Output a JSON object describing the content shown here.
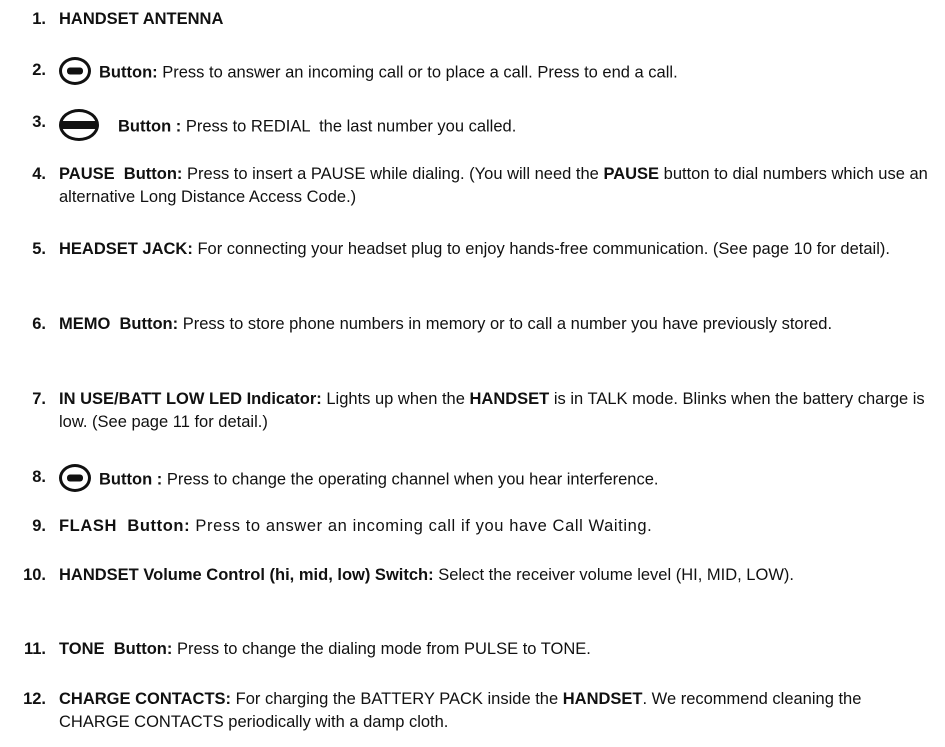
{
  "items": [
    {
      "number": "1.",
      "title": "HANDSET ANTENNA"
    },
    {
      "number": "2.",
      "icon": "talk-button-icon",
      "title": "Button:",
      "desc": "Press to answer an incoming call or to place a call. Press to end a call."
    },
    {
      "number": "3.",
      "icon": "redial-button-icon",
      "title": "Button :",
      "desc": "Press to REDIAL  the last number you called."
    },
    {
      "number": "4.",
      "title": "PAUSE  Button:",
      "desc_a": "Press to insert a PAUSE while dialing. (You will need the",
      "emph": "PAUSE",
      "desc_b": "button to dial numbers which use an alternative Long Distance Access Code.)"
    },
    {
      "number": "5.",
      "title": "HEADSET JACK:",
      "desc": "For connecting your headset plug to enjoy hands-free communication. (See page 10 for detail)."
    },
    {
      "number": "6.",
      "title": "MEMO  Button:",
      "desc": "Press to store phone numbers in memory or to call a number you have previously stored."
    },
    {
      "number": "7.",
      "title": "IN USE/BATT LOW LED Indicator:",
      "desc_a": "Lights up when the",
      "emph": "HANDSET",
      "desc_b": "is in TALK mode. Blinks when the battery charge is low. (See page 11 for detail.)"
    },
    {
      "number": "8.",
      "icon": "channel-button-icon",
      "title": "Button :",
      "desc": "Press to change the operating channel when you hear interference."
    },
    {
      "number": "9.",
      "title": "FLASH  Button:",
      "desc": "Press to answer an incoming call if you have Call Waiting."
    },
    {
      "number": "10.",
      "title": "HANDSET Volume Control (hi, mid, low) Switch:",
      "desc": "Select the receiver volume level (HI, MID, LOW)."
    },
    {
      "number": "11.",
      "title": "TONE  Button:",
      "desc": "Press to change the dialing mode from PULSE to TONE."
    },
    {
      "number": "12.",
      "title": "CHARGE CONTACTS:",
      "desc_a": "For charging the BATTERY PACK inside the",
      "emph": "HANDSET",
      "desc_b": ". We recommend cleaning the CHARGE CONTACTS periodically with a damp cloth."
    }
  ]
}
